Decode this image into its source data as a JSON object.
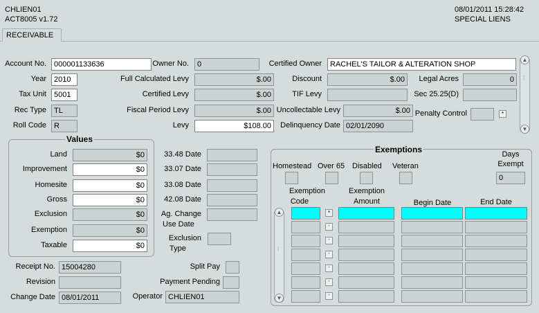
{
  "header": {
    "app_id": "CHLIEN01",
    "version": "ACT8005 v1.72",
    "datetime": "08/01/2011 15:28:42",
    "module": "SPECIAL LIENS"
  },
  "tabs": [
    {
      "label": "RECEIVABLE"
    }
  ],
  "form": {
    "account_no_label": "Account No.",
    "account_no": "000001133636",
    "owner_no_label": "Owner No.",
    "owner_no": "0",
    "certified_owner_label": "Certified Owner",
    "certified_owner": "RACHEL'S TAILOR & ALTERATION SHOP",
    "year_label": "Year",
    "year": "2010",
    "full_calc_levy_label": "Full Calculated Levy",
    "full_calc_levy": "$.00",
    "discount_label": "Discount",
    "discount": "$.00",
    "legal_acres_label": "Legal Acres",
    "legal_acres": "0",
    "tax_unit_label": "Tax Unit",
    "tax_unit": "5001",
    "certified_levy_label": "Certified Levy",
    "certified_levy": "$.00",
    "tif_levy_label": "TIF Levy",
    "tif_levy": "",
    "sec_label": "Sec 25.25(D)",
    "sec": "",
    "rec_type_label": "Rec Type",
    "rec_type": "TL",
    "fiscal_period_levy_label": "Fiscal Period Levy",
    "fiscal_period_levy": "$.00",
    "uncollectable_levy_label": "Uncollectable Levy",
    "uncollectable_levy": "$.00",
    "penalty_control_label": "Penalty Control",
    "penalty_control": "",
    "roll_code_label": "Roll Code",
    "roll_code": "R",
    "levy_label": "Levy",
    "levy": "$108.00",
    "delinquency_date_label": "Delinquency Date",
    "delinquency_date": "02/01/2090"
  },
  "values": {
    "title": "Values",
    "land_label": "Land",
    "land": "$0",
    "improvement_label": "Improvement",
    "improvement": "$0",
    "homesite_label": "Homesite",
    "homesite": "$0",
    "gross_label": "Gross",
    "gross": "$0",
    "exclusion_label": "Exclusion",
    "exclusion": "$0",
    "exemption_label": "Exemption",
    "exemption": "$0",
    "taxable_label": "Taxable",
    "taxable": "$0"
  },
  "dates": {
    "d3348_label": "33.48 Date",
    "d3307_label": "33.07 Date",
    "d3308_label": "33.08 Date",
    "d4208_label": "42.08 Date",
    "ag_change_label": "Ag. Change",
    "use_date_label": "Use Date",
    "exclusion_label": "Exclusion",
    "type_label": "Type"
  },
  "receipt": {
    "receipt_no_label": "Receipt No.",
    "receipt_no": "15004280",
    "revision_label": "Revision",
    "revision": "",
    "change_date_label": "Change Date",
    "change_date": "08/01/2011",
    "split_pay_label": "Split Pay",
    "payment_pending_label": "Payment Pending",
    "operator_label": "Operator",
    "operator": "CHLIEN01"
  },
  "exemptions": {
    "title": "Exemptions",
    "homestead_label": "Homestead",
    "over65_label": "Over 65",
    "disabled_label": "Disabled",
    "veteran_label": "Veteran",
    "days_label": "Days",
    "exempt_label": "Exempt",
    "days_exempt": "0",
    "col_code_1": "Exemption",
    "col_code_2": "Code",
    "col_amount_1": "Exemption",
    "col_amount_2": "Amount",
    "col_begin": "Begin Date",
    "col_end": "End Date",
    "rows": [
      {
        "code": "",
        "amount": "",
        "begin": "",
        "end": ""
      },
      {
        "code": "",
        "amount": "",
        "begin": "",
        "end": ""
      },
      {
        "code": "",
        "amount": "",
        "begin": "",
        "end": ""
      },
      {
        "code": "",
        "amount": "",
        "begin": "",
        "end": ""
      },
      {
        "code": "",
        "amount": "",
        "begin": "",
        "end": ""
      },
      {
        "code": "",
        "amount": "",
        "begin": "",
        "end": ""
      },
      {
        "code": "",
        "amount": "",
        "begin": "",
        "end": ""
      }
    ]
  },
  "icons": {
    "lookup": "asterisk-button-icon",
    "scroll_up": "scroll-up-arrow-icon",
    "scroll_down": "scroll-down-arrow-icon"
  }
}
